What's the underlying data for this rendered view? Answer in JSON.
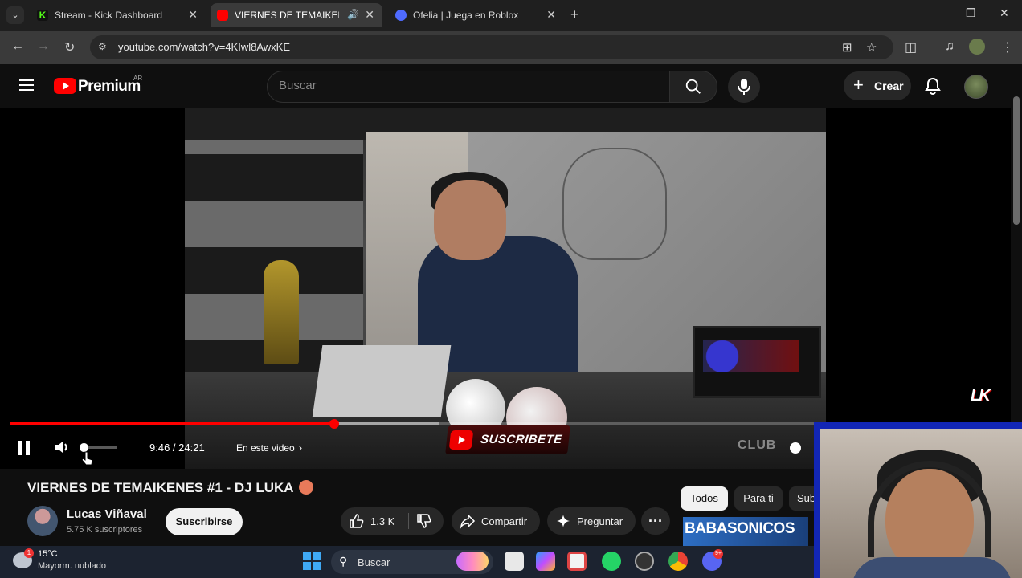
{
  "browser": {
    "tabs": [
      {
        "title": "Stream - Kick Dashboard",
        "favicon": "kick-icon",
        "color": "#53fc18"
      },
      {
        "title": "VIERNES DE TEMAIKENES #",
        "favicon": "youtube-icon",
        "color": "#ff0000",
        "active": true
      },
      {
        "title": "Ofelia | Juega en Roblox",
        "favicon": "roblox-icon",
        "color": "#4f6bff"
      }
    ],
    "url": "youtube.com/watch?v=4KIwl8AwxKE"
  },
  "youtube": {
    "brand": "Premium",
    "region": "AR",
    "search_placeholder": "Buscar",
    "create_label": "Crear",
    "accent": "#ff0000"
  },
  "player": {
    "progress_fraction": 0.4,
    "buffer_fraction": 0.53,
    "volume_fraction": 0.0,
    "time": "9:46 / 24:21",
    "chapter_label": "En este video",
    "overlay_text": "SUSCRIBETE",
    "watermark": "LK",
    "corner_logo": "CLUB"
  },
  "video": {
    "title": "VIERNES DE TEMAIKENES #1 - DJ LUKA",
    "channel": "Lucas Viñaval",
    "subscribers": "5.75 K suscriptores",
    "subscribe_label": "Suscribirse",
    "likes": "1.3 K",
    "share_label": "Compartir",
    "ask_label": "Preguntar",
    "more_label": "···"
  },
  "chips": [
    "Todos",
    "Para ti",
    "Sub"
  ],
  "recommendation": {
    "thumb_text": "BABASONICOS"
  },
  "taskbar": {
    "temperature": "15°C",
    "condition": "Mayorm. nublado",
    "search_label": "Buscar",
    "weather_badge": "1",
    "discord_badge": "9+"
  }
}
